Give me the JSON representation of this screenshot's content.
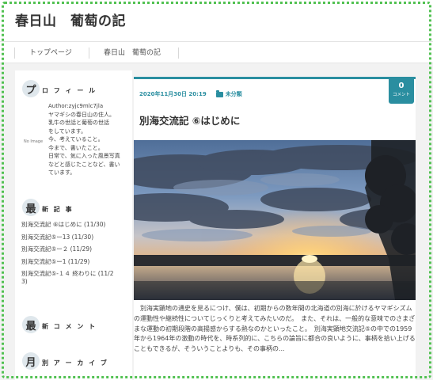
{
  "site": {
    "title": "春日山　葡萄の記"
  },
  "nav": {
    "items": [
      "トップページ",
      "春日山　葡萄の記"
    ]
  },
  "sidebar": {
    "profile": {
      "initial": "プ",
      "label": "ロ フ ィ ー ル",
      "noimage": "No Image",
      "lines": [
        "Author:zyjc9mlc7jla",
        "ヤマギシの春日山の住人。",
        "乳牛の世話と葡萄の世話",
        "をしています。",
        "今、考えていること。",
        "今まで、書いたこと。",
        "日常で、気に入った風景写真",
        "などと感じたことなど、書い",
        "ています。"
      ]
    },
    "recent": {
      "initial": "最",
      "label": "新 記 事",
      "items": [
        "別海交流記 ⑥はじめに (11/30)",
        "別海交流記⑤ー13 (11/30)",
        "別海交流記⑤ー２ (11/29)",
        "別海交流記⑤ー1 (11/29)",
        "別海交流記⑤-１４ 終わりに (11/2",
        "3)"
      ]
    },
    "comments": {
      "initial": "最",
      "label": "新 コ メ ン ト"
    },
    "archive": {
      "initial": "月",
      "label": "別 ア ー カ イ ブ"
    }
  },
  "post": {
    "datetime": "2020年11月30日 20:19",
    "category": "未分類",
    "comment_count": "0",
    "comment_label": "コメント",
    "title": "別海交流記 ⑥はじめに",
    "excerpt": "別海実顕地の通史を見るにつけ、僕は、初期からの数年間の北海道の別海に於けるヤマギシズムの運動性や継続性についてじっくりと考えてみたいのだ。　また、それは、一般的な意味でのさまざまな運動の初期段階の高揚感からする熱なのかといったこと。　別海実顕地交流記⑤の中での1959年から1964年の激動の時代を、時系列的に、こちらの論旨に都合の良いように、事柄を拾い上げることもできるが、そういうことよりも、その事柄の..."
  },
  "colors": {
    "accent": "#2a8ea0",
    "frame": "#52c152"
  }
}
